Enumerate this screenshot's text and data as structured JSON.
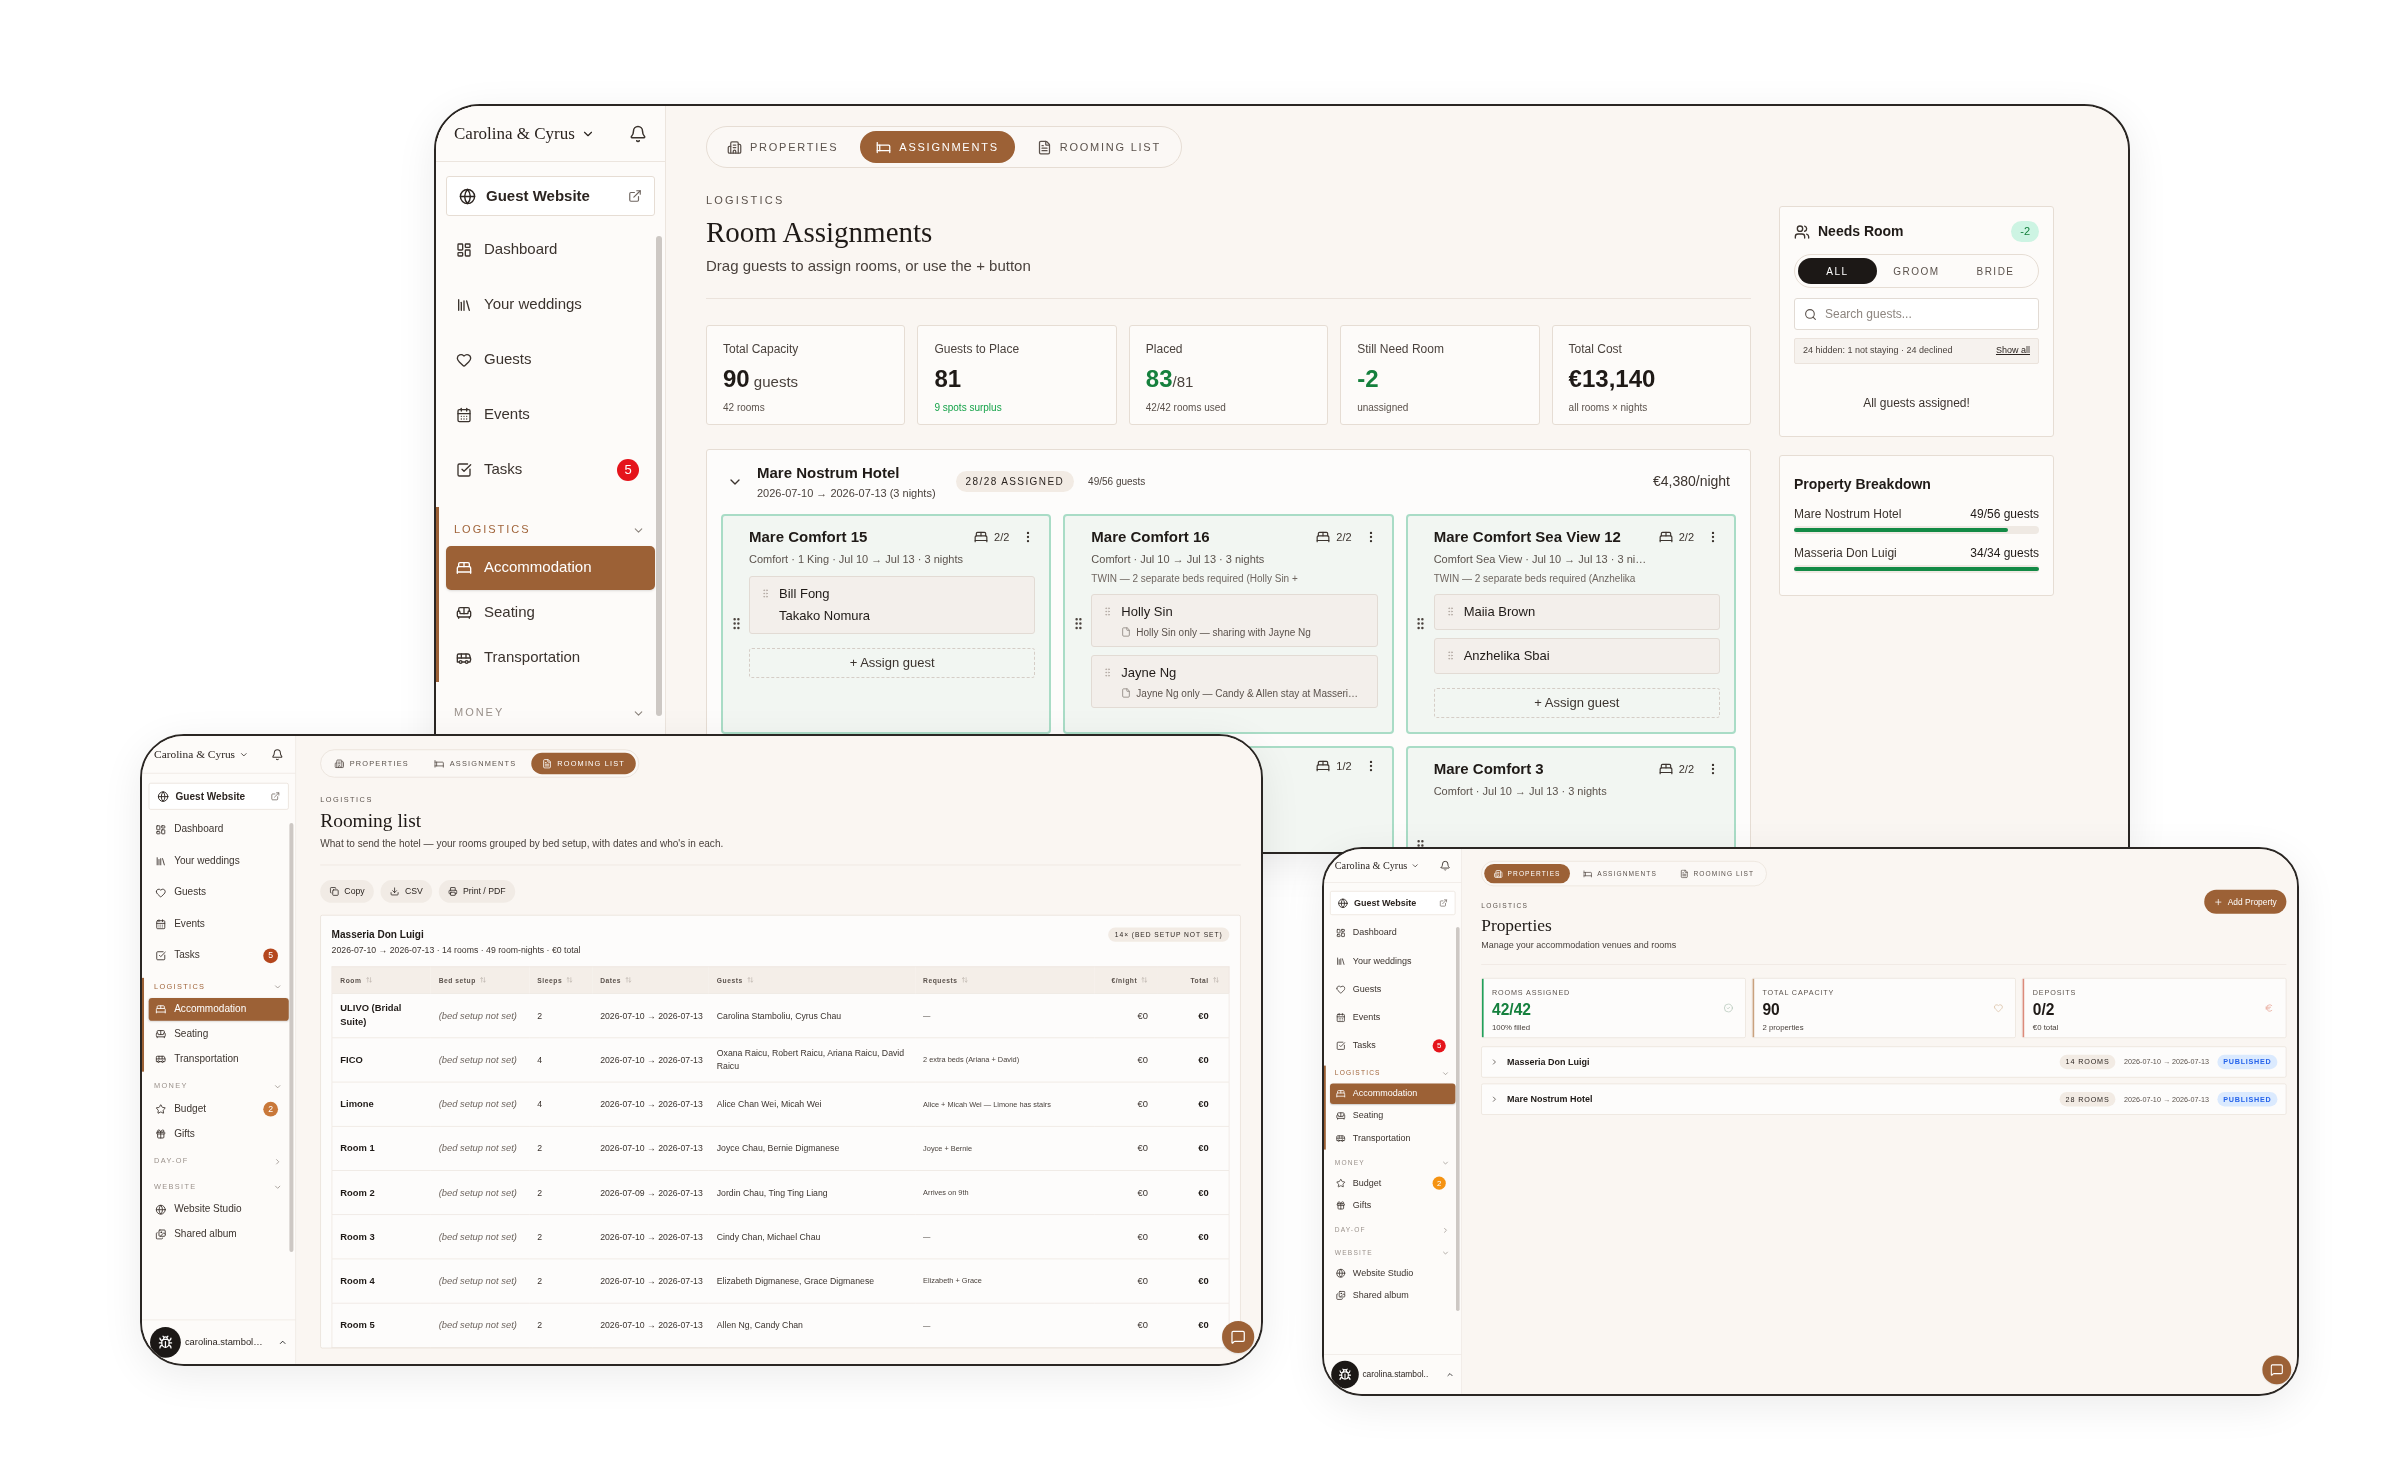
{
  "screens": [
    {
      "kind": "assignments",
      "sidebar": {
        "workspace": "Carolina & Cyrus",
        "website": "Guest Website",
        "nav": [
          {
            "kind": "item",
            "label": "Dashboard",
            "selected": false
          },
          {
            "kind": "item",
            "label": "Your weddings",
            "selected": false
          },
          {
            "kind": "item",
            "label": "Guests",
            "selected": false
          },
          {
            "kind": "item",
            "label": "Events",
            "selected": false
          },
          {
            "kind": "item",
            "label": "Tasks",
            "selected": false,
            "badge": "5",
            "color": "#e5141b"
          },
          {
            "kind": "section",
            "label": "LOGISTICS",
            "expanded": true,
            "active": true
          },
          {
            "kind": "item",
            "label": "Accommodation",
            "selected": true
          },
          {
            "kind": "item",
            "label": "Seating",
            "selected": false
          },
          {
            "kind": "item",
            "label": "Transportation",
            "selected": false
          },
          {
            "kind": "section",
            "label": "MONEY",
            "expanded": true,
            "active": false
          }
        ]
      },
      "tabs": [
        {
          "label": "PROPERTIES",
          "selected": false
        },
        {
          "label": "ASSIGNMENTS",
          "selected": true
        },
        {
          "label": "ROOMING LIST",
          "selected": false
        }
      ],
      "header": {
        "eyebrow": "LOGISTICS",
        "title": "Room Assignments",
        "subtitle": "Drag guests to assign rooms, or use the + button"
      },
      "stats": [
        {
          "label": "Total Capacity",
          "value": "90",
          "suffix": " guests",
          "note": "42 rooms",
          "value_good": false,
          "note_good": false
        },
        {
          "label": "Guests to Place",
          "value": "81",
          "note": "9 spots surplus",
          "value_good": false,
          "note_good": true
        },
        {
          "label": "Placed",
          "value": "83",
          "suffix": "/81",
          "note": "42/42 rooms used",
          "value_good": true,
          "note_good": false
        },
        {
          "label": "Still Need Room",
          "value": "-2",
          "note": "unassigned",
          "value_good": true,
          "note_good": false
        },
        {
          "label": "Total Cost",
          "value": "€13,140",
          "note": "all rooms × nights",
          "value_good": false,
          "note_good": false
        }
      ],
      "property": {
        "name": "Mare Nostrum Hotel",
        "dates": "2026-07-10 → 2026-07-13 (3 nights)",
        "badge": "28/28 ASSIGNED",
        "guests": "49/56 guests",
        "rate": "€4,380/night",
        "expanded": true,
        "rooms": [
          {
            "name": "Mare Comfort 15",
            "capacity": "2/2",
            "details": "Comfort · 1 King · Jul 10 → Jul 13 · 3 nights",
            "slots": [
              {
                "names": [
                  "Bill Fong",
                  "Takako Nomura"
                ]
              }
            ],
            "assign": "+ Assign guest"
          },
          {
            "name": "Mare Comfort 16",
            "capacity": "2/2",
            "details": "Comfort · Jul 10 → Jul 13 · 3 nights",
            "note": "TWIN — 2 separate beds required (Holly Sin +",
            "slots": [
              {
                "names": [
                  "Holly Sin"
                ],
                "note": "Holly Sin only — sharing with Jayne Ng"
              },
              {
                "names": [
                  "Jayne Ng"
                ],
                "note": "Jayne Ng only — Candy & Allen stay at Masseri…"
              }
            ]
          },
          {
            "name": "Mare Comfort Sea View 12",
            "capacity": "2/2",
            "details": "Comfort Sea View · Jul 10 → Jul 13 · 3 ni…",
            "note": "TWIN — 2 separate beds required (Anzhelika",
            "slots": [
              {
                "names": [
                  "Maiia Brown"
                ]
              },
              {
                "names": [
                  "Anzhelika Sbai"
                ]
              }
            ],
            "assign": "+ Assign guest"
          },
          {
            "capacity": "1/2"
          },
          {
            "name": "Mare Comfort 3",
            "capacity": "2/2",
            "details": "Comfort · Jul 10 → Jul 13 · 3 nights"
          }
        ]
      },
      "needs_room": {
        "title": "Needs Room",
        "count": "-2",
        "filters": [
          {
            "label": "ALL",
            "selected": true
          },
          {
            "label": "GROOM",
            "selected": false
          },
          {
            "label": "BRIDE",
            "selected": false
          }
        ],
        "search_placeholder": "Search guests...",
        "hidden_info": "24 hidden: 1 not staying · 24 declined",
        "show_all": "Show all",
        "empty": "All guests assigned!"
      },
      "breakdown": {
        "title": "Property Breakdown",
        "items": [
          {
            "name": "Mare Nostrum Hotel",
            "reading": "49/56 guests",
            "level": 0.875
          },
          {
            "name": "Masseria Don Luigi",
            "reading": "34/34 guests",
            "level": 1
          }
        ]
      }
    },
    {
      "kind": "rooming_list",
      "sidebar": {
        "workspace": "Carolina & Cyrus",
        "website": "Guest Website",
        "user": "carolina.stambol…",
        "nav": [
          {
            "kind": "item",
            "label": "Dashboard",
            "selected": false
          },
          {
            "kind": "item",
            "label": "Your weddings",
            "selected": false
          },
          {
            "kind": "item",
            "label": "Guests",
            "selected": false
          },
          {
            "kind": "item",
            "label": "Events",
            "selected": false
          },
          {
            "kind": "item",
            "label": "Tasks",
            "selected": false,
            "badge": "5",
            "color": "#b4461d"
          },
          {
            "kind": "section",
            "label": "LOGISTICS",
            "expanded": true,
            "active": true
          },
          {
            "kind": "item",
            "label": "Accommodation",
            "selected": true
          },
          {
            "kind": "item",
            "label": "Seating",
            "selected": false
          },
          {
            "kind": "item",
            "label": "Transportation",
            "selected": false
          },
          {
            "kind": "section",
            "label": "MONEY",
            "expanded": true,
            "active": false
          },
          {
            "kind": "item",
            "label": "Budget",
            "selected": false,
            "badge": "2",
            "color": "#c9783a"
          },
          {
            "kind": "item",
            "label": "Gifts",
            "selected": false
          },
          {
            "kind": "section",
            "label": "DAY-OF",
            "expanded": false,
            "active": false
          },
          {
            "kind": "section",
            "label": "WEBSITE",
            "expanded": true,
            "active": false
          },
          {
            "kind": "item",
            "label": "Website Studio",
            "selected": false
          },
          {
            "kind": "item",
            "label": "Shared album",
            "selected": false
          }
        ]
      },
      "tabs": [
        {
          "label": "PROPERTIES",
          "selected": false
        },
        {
          "label": "ASSIGNMENTS",
          "selected": false
        },
        {
          "label": "ROOMING LIST",
          "selected": true
        }
      ],
      "header": {
        "eyebrow": "LOGISTICS",
        "title": "Rooming list",
        "subtitle": "What to send the hotel — your rooms grouped by bed setup, with dates and who's in each."
      },
      "actions": [
        "Copy",
        "CSV",
        "Print / PDF"
      ],
      "group": {
        "name": "Masseria Don Luigi",
        "meta": "2026-07-10 → 2026-07-13 · 14 rooms · 49 room-nights · €0 total",
        "badge": "14× (BED SETUP NOT SET)",
        "columns": [
          {
            "label": "Room",
            "kind": "name"
          },
          {
            "label": "Bed setup",
            "kind": "unset"
          },
          {
            "label": "Sleeps",
            "kind": "text"
          },
          {
            "label": "Dates",
            "kind": "text"
          },
          {
            "label": "Guests",
            "kind": "text"
          },
          {
            "label": "Requests",
            "kind": "small"
          },
          {
            "label": "€/night",
            "kind": "money"
          },
          {
            "label": "Total",
            "kind": "total"
          }
        ],
        "rows": [
          [
            "ULIVO (Bridal Suite)",
            "(bed setup not set)",
            "2",
            "2026-07-10 → 2026-07-13",
            "Carolina Stamboliu, Cyrus Chau",
            "—",
            "€0",
            "€0"
          ],
          [
            "FICO",
            "(bed setup not set)",
            "4",
            "2026-07-10 → 2026-07-13",
            "Oxana Raicu, Robert Raicu, Ariana Raicu, David Raicu",
            "2 extra beds (Ariana + David)",
            "€0",
            "€0"
          ],
          [
            "Limone",
            "(bed setup not set)",
            "4",
            "2026-07-10 → 2026-07-13",
            "Alice Chan Wei, Micah Wei",
            "Alice + Micah Wei — Limone has stairs",
            "€0",
            "€0"
          ],
          [
            "Room 1",
            "(bed setup not set)",
            "2",
            "2026-07-10 → 2026-07-13",
            "Joyce Chau, Bernie Digmanese",
            "Joyce + Bernie",
            "€0",
            "€0"
          ],
          [
            "Room 2",
            "(bed setup not set)",
            "2",
            "2026-07-09 → 2026-07-13",
            "Jordin Chau, Ting Ting Liang",
            "Arrives on 9th",
            "€0",
            "€0"
          ],
          [
            "Room 3",
            "(bed setup not set)",
            "2",
            "2026-07-10 → 2026-07-13",
            "Cindy Chan, Michael Chau",
            "—",
            "€0",
            "€0"
          ],
          [
            "Room 4",
            "(bed setup not set)",
            "2",
            "2026-07-10 → 2026-07-13",
            "Elizabeth Digmanese, Grace Digmanese",
            "Elizabeth + Grace",
            "€0",
            "€0"
          ],
          [
            "Room 5",
            "(bed setup not set)",
            "2",
            "2026-07-10 → 2026-07-13",
            "Allen Ng, Candy Chan",
            "—",
            "€0",
            "€0"
          ]
        ]
      }
    },
    {
      "kind": "properties",
      "sidebar": {
        "workspace": "Carolina & Cyrus",
        "website": "Guest Website",
        "user": "carolina.stambol..",
        "nav": [
          {
            "kind": "item",
            "label": "Dashboard",
            "selected": false
          },
          {
            "kind": "item",
            "label": "Your weddings",
            "selected": false
          },
          {
            "kind": "item",
            "label": "Guests",
            "selected": false
          },
          {
            "kind": "item",
            "label": "Events",
            "selected": false
          },
          {
            "kind": "item",
            "label": "Tasks",
            "selected": false,
            "badge": "5",
            "color": "#e5141b"
          },
          {
            "kind": "section",
            "label": "LOGISTICS",
            "expanded": true,
            "active": true
          },
          {
            "kind": "item",
            "label": "Accommodation",
            "selected": true
          },
          {
            "kind": "item",
            "label": "Seating",
            "selected": false
          },
          {
            "kind": "item",
            "label": "Transportation",
            "selected": false
          },
          {
            "kind": "section",
            "label": "MONEY",
            "expanded": true,
            "active": false
          },
          {
            "kind": "item",
            "label": "Budget",
            "selected": false,
            "badge": "2",
            "color": "#f59312"
          },
          {
            "kind": "item",
            "label": "Gifts",
            "selected": false
          },
          {
            "kind": "section",
            "label": "DAY-OF",
            "expanded": false,
            "active": false
          },
          {
            "kind": "section",
            "label": "WEBSITE",
            "expanded": true,
            "active": false
          },
          {
            "kind": "item",
            "label": "Website Studio",
            "selected": false
          },
          {
            "kind": "item",
            "label": "Shared album",
            "selected": false
          }
        ]
      },
      "tabs": [
        {
          "label": "PROPERTIES",
          "selected": true
        },
        {
          "label": "ASSIGNMENTS",
          "selected": false
        },
        {
          "label": "ROOMING LIST",
          "selected": false
        }
      ],
      "header": {
        "eyebrow": "LOGISTICS",
        "title": "Properties",
        "subtitle": "Manage your accommodation venues and rooms"
      },
      "add_button": "Add Property",
      "stats": [
        {
          "label": "ROOMS ASSIGNED",
          "value": "42/42",
          "note": "100% filled",
          "value_good": true,
          "color": "#22a05a"
        },
        {
          "label": "TOTAL CAPACITY",
          "value": "90",
          "note": "2 properties",
          "value_good": false,
          "color": "#c9a27e"
        },
        {
          "label": "DEPOSITS",
          "value": "0/2",
          "note": "€0 total",
          "value_good": false,
          "color": "#dc8a7a"
        }
      ],
      "properties": [
        {
          "name": "Masseria Don Luigi",
          "rooms": "14 ROOMS",
          "dates": "2026-07-10 → 2026-07-13",
          "status": "PUBLISHED",
          "expanded": false
        },
        {
          "name": "Mare Nostrum Hotel",
          "rooms": "28 ROOMS",
          "dates": "2026-07-10 → 2026-07-13",
          "status": "PUBLISHED",
          "expanded": false
        }
      ]
    }
  ]
}
